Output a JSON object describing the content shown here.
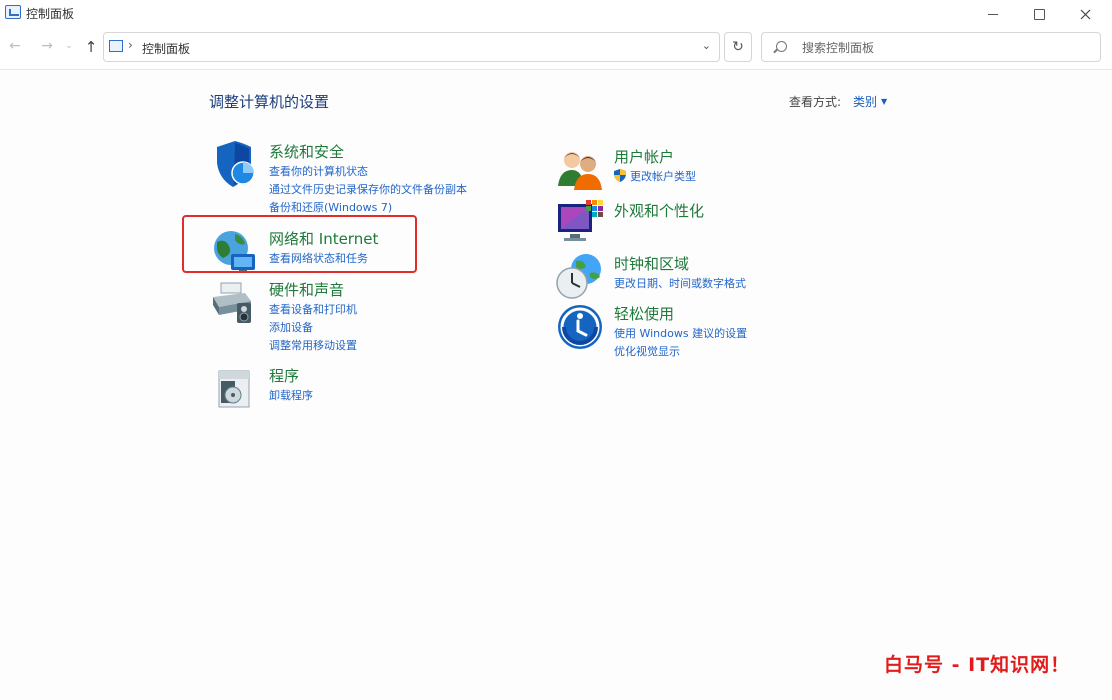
{
  "window": {
    "title": "控制面板"
  },
  "nav": {
    "back": "←",
    "forward": "→",
    "recent": "⌄",
    "up": "↑",
    "address_sep": "›",
    "address": "控制面板",
    "dropdown": "⌄",
    "refresh": "↻",
    "search_placeholder": "搜索控制面板"
  },
  "main": {
    "title": "调整计算机的设置",
    "view_by_label": "查看方式:",
    "view_by_value": "类别"
  },
  "categories": [
    {
      "title": "系统和安全",
      "links": [
        "查看你的计算机状态",
        "通过文件历史记录保存你的文件备份副本",
        "备份和还原(Windows 7)"
      ],
      "icon": "shield-icon"
    },
    {
      "title": "网络和 Internet",
      "links": [
        "查看网络状态和任务"
      ],
      "icon": "network-globe-icon"
    },
    {
      "title": "硬件和声音",
      "links": [
        "查看设备和打印机",
        "添加设备",
        "调整常用移动设置"
      ],
      "icon": "printer-icon"
    },
    {
      "title": "程序",
      "links": [
        "卸载程序"
      ],
      "icon": "programs-box-icon"
    },
    {
      "title": "用户帐户",
      "links": [
        "更改帐户类型"
      ],
      "icon": "users-icon"
    },
    {
      "title": "外观和个性化",
      "links": [],
      "icon": "monitor-palette-icon"
    },
    {
      "title": "时钟和区域",
      "links": [
        "更改日期、时间或数字格式"
      ],
      "icon": "clock-globe-icon"
    },
    {
      "title": "轻松使用",
      "links": [
        "使用 Windows 建议的设置",
        "优化视觉显示"
      ],
      "icon": "accessibility-icon"
    }
  ],
  "colors": {
    "category_title": "#1f7a3a",
    "link": "#2266c8",
    "highlight": "#e22b2b"
  },
  "watermark": "白马号 - IT知识网！"
}
